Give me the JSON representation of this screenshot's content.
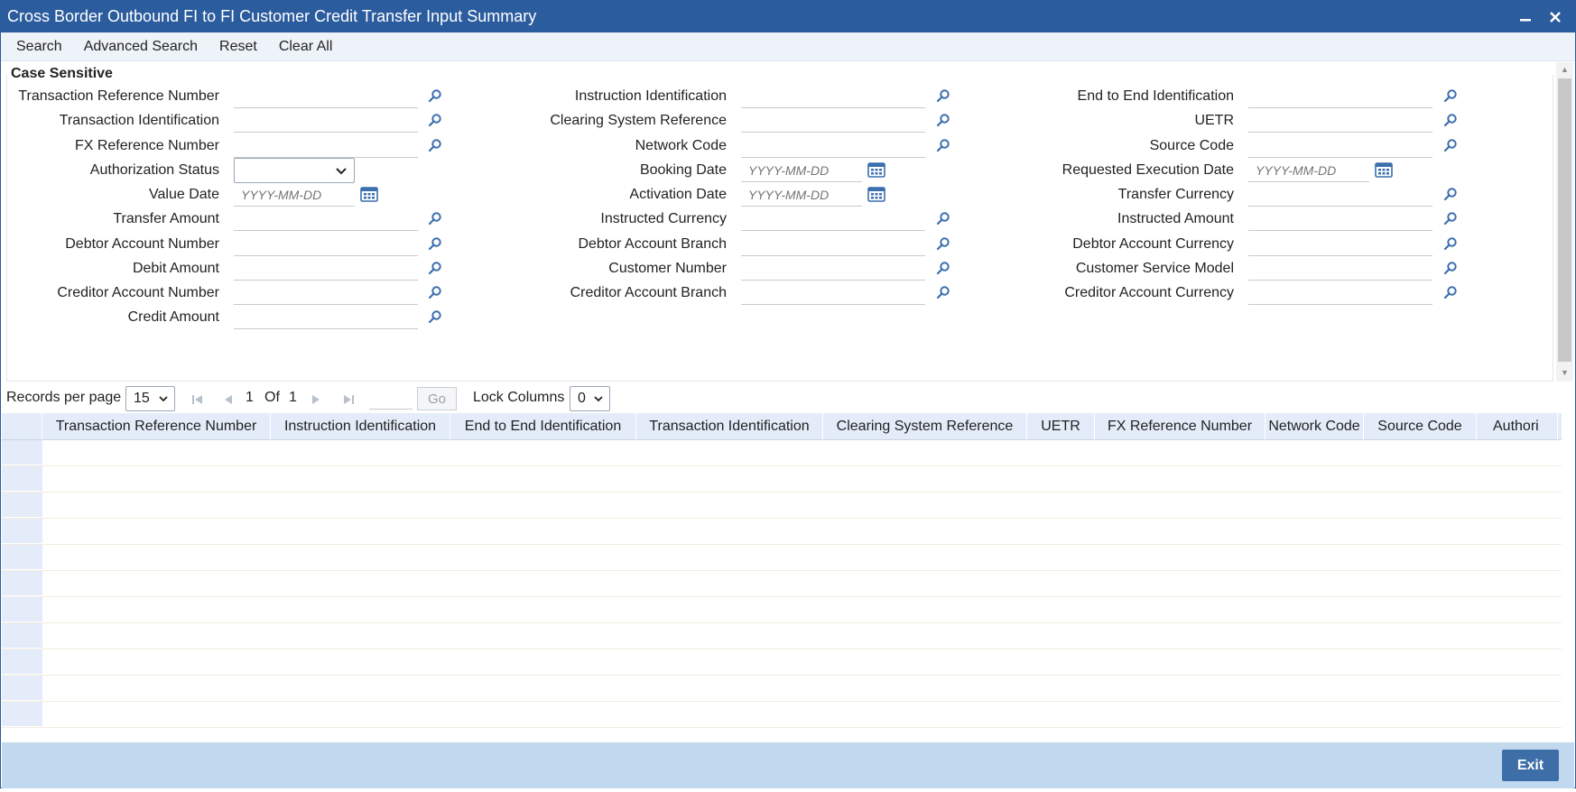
{
  "window": {
    "title": "Cross Border Outbound FI to FI Customer Credit Transfer Input Summary"
  },
  "menu": {
    "search": "Search",
    "advanced_search": "Advanced Search",
    "reset": "Reset",
    "clear_all": "Clear All"
  },
  "criteria": {
    "legend": "Case Sensitive",
    "date_placeholder": "YYYY-MM-DD",
    "col1": [
      "Transaction Reference Number",
      "Transaction Identification",
      "FX Reference Number",
      "Authorization Status",
      "Value Date",
      "Transfer Amount",
      "Debtor Account Number",
      "Debit Amount",
      "Creditor Account Number",
      "Credit Amount"
    ],
    "col2": [
      "Instruction Identification",
      "Clearing System Reference",
      "Network Code",
      "Booking Date",
      "Activation Date",
      "Instructed Currency",
      "Debtor Account Branch",
      "Customer Number",
      "Creditor Account Branch"
    ],
    "col3": [
      "End to End Identification",
      "UETR",
      "Source Code",
      "Requested Execution Date",
      "Transfer Currency",
      "Instructed Amount",
      "Debtor Account Currency",
      "Customer Service Model",
      "Creditor Account Currency"
    ]
  },
  "pager": {
    "records_per_page_label": "Records per page",
    "records_per_page_value": "15",
    "current_page": "1",
    "of_label": "Of",
    "total_pages": "1",
    "go_label": "Go",
    "lock_columns_label": "Lock Columns",
    "lock_columns_value": "0"
  },
  "grid": {
    "columns": [
      "Transaction Reference Number",
      "Instruction Identification",
      "End to End Identification",
      "Transaction Identification",
      "Clearing System Reference",
      "UETR",
      "FX Reference Number",
      "Network Code",
      "Source Code",
      "Authori"
    ],
    "row_count": 11
  },
  "footer": {
    "exit_label": "Exit"
  },
  "colors": {
    "title_bar": "#2b5c9e",
    "accent": "#3d6ea8",
    "footer": "#c1d8ee",
    "grid_header": "#e3ecf8"
  },
  "icons": {
    "lookup": "search-icon",
    "calendar": "calendar-icon",
    "minimize": "minimize-icon",
    "close": "close-icon"
  }
}
